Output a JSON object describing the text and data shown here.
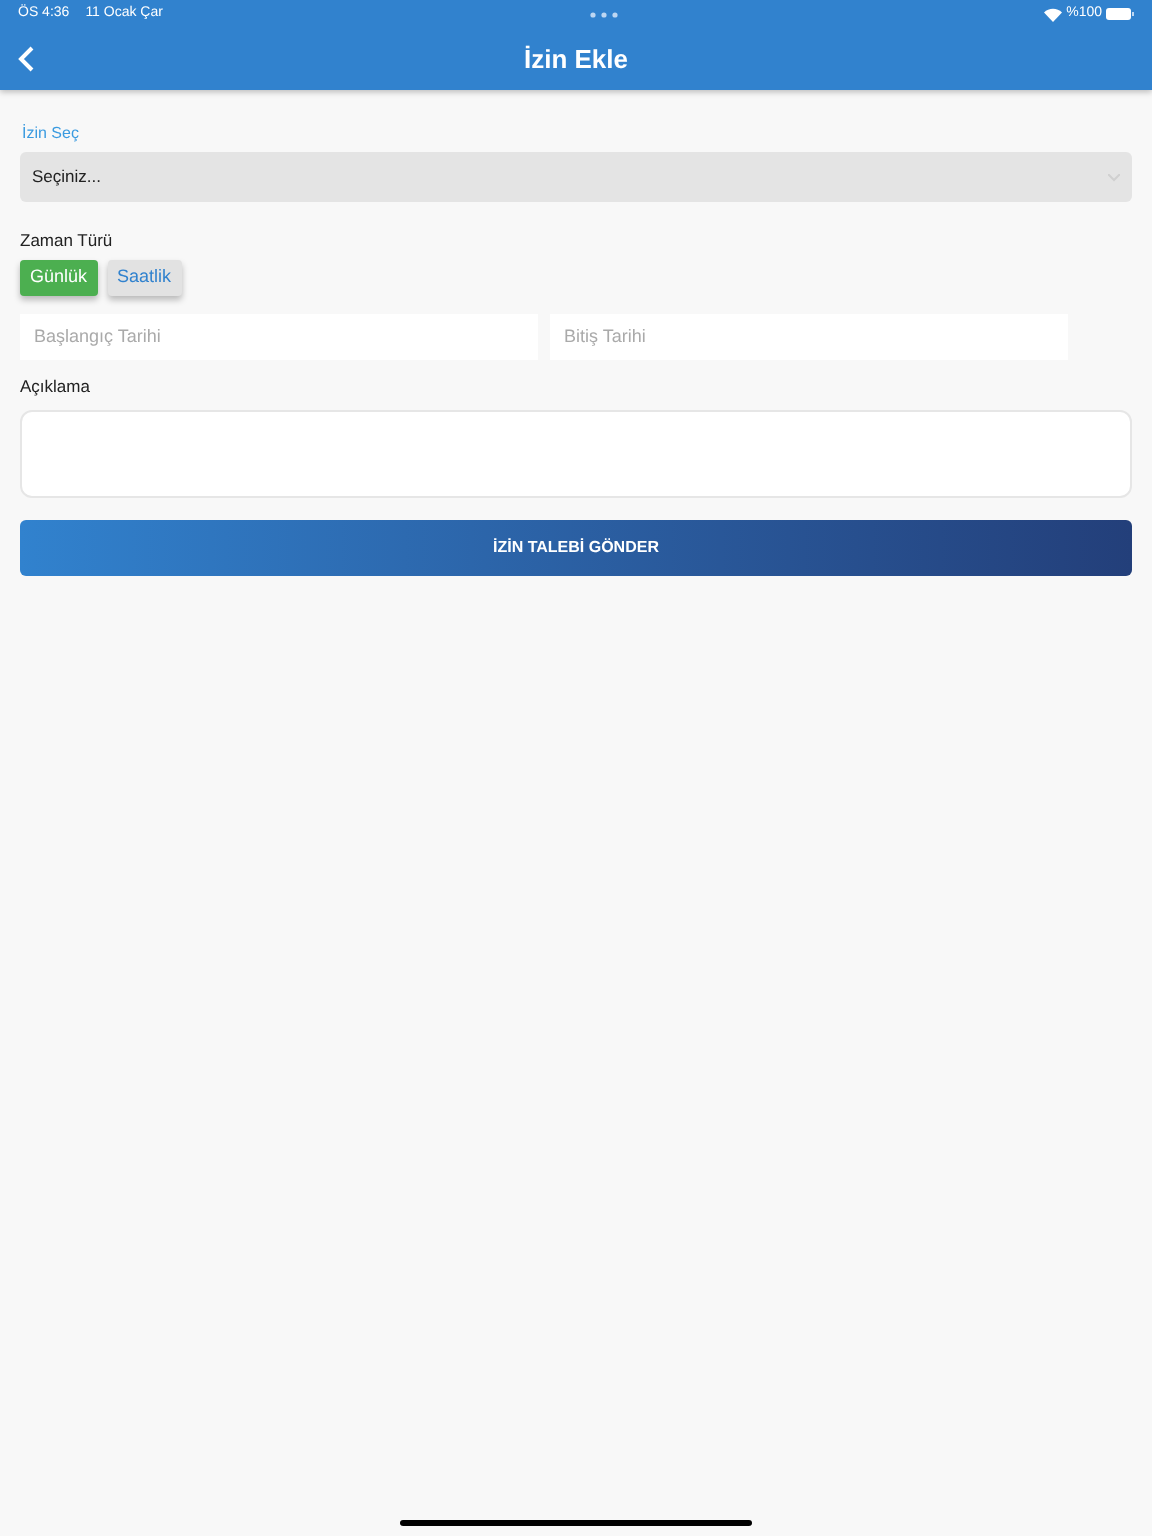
{
  "status_bar": {
    "time": "ÖS 4:36",
    "date": "11 Ocak Çar",
    "battery": "%100"
  },
  "header": {
    "title": "İzin Ekle"
  },
  "leave_select": {
    "label": "İzin Seç",
    "value": "Seçiniz..."
  },
  "time_type": {
    "label": "Zaman Türü",
    "options": [
      {
        "label": "Günlük",
        "selected": true
      },
      {
        "label": "Saatlik",
        "selected": false
      }
    ]
  },
  "start_date": {
    "placeholder": "Başlangıç Tarihi"
  },
  "end_date": {
    "placeholder": "Bitiş Tarihi"
  },
  "description": {
    "label": "Açıklama"
  },
  "submit_button": "İZİN TALEBİ GÖNDER"
}
